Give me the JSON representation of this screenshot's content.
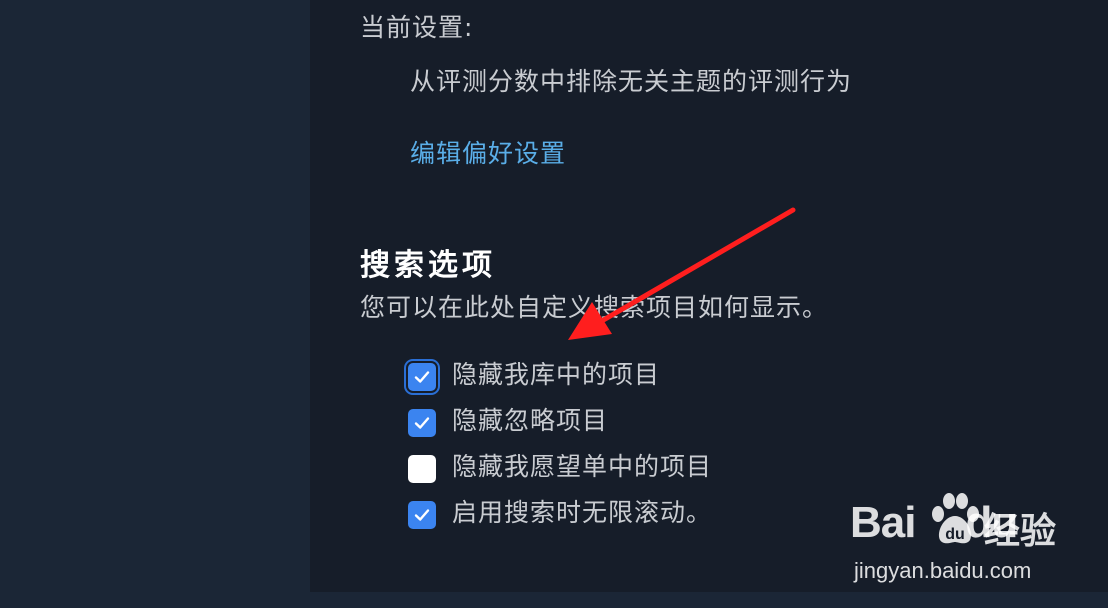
{
  "current_settings": {
    "label": "当前设置:",
    "value": "从评测分数中排除无关主题的评测行为",
    "edit_link": "编辑偏好设置"
  },
  "search_options": {
    "title": "搜索选项",
    "description": "您可以在此处自定义搜索项目如何显示。",
    "options": [
      {
        "label": "隐藏我库中的项目",
        "checked": true,
        "focused": true
      },
      {
        "label": "隐藏忽略项目",
        "checked": true,
        "focused": false
      },
      {
        "label": "隐藏我愿望单中的项目",
        "checked": false,
        "focused": false
      },
      {
        "label": "启用搜索时无限滚动。",
        "checked": true,
        "focused": false
      }
    ]
  },
  "watermark": {
    "brand_left": "Bai",
    "brand_right": "du",
    "product": "经验",
    "url": "jingyan.baidu.com"
  },
  "colors": {
    "panel_bg": "#161d29",
    "outer_bg": "#1b2636",
    "link": "#5aaee8",
    "checkbox_checked": "#3b84f0",
    "annotation_arrow": "#ff1e1e"
  }
}
